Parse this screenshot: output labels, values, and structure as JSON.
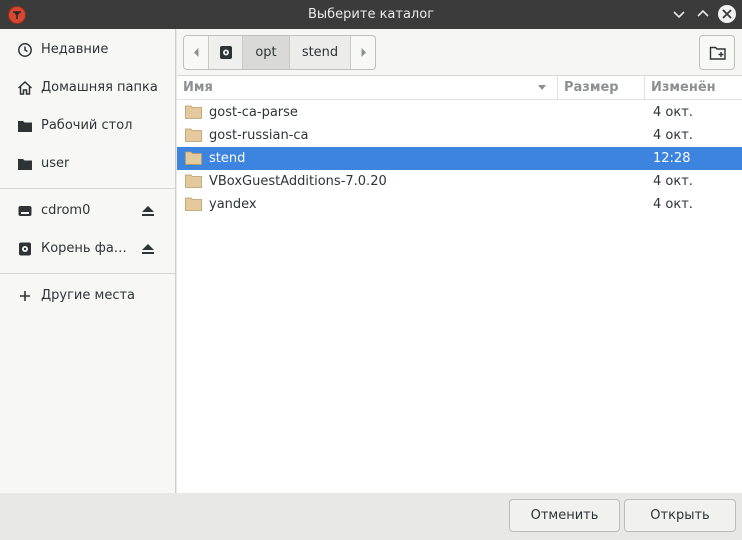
{
  "window": {
    "title": "Выберите каталог"
  },
  "sidebar": {
    "items": [
      {
        "label": "Недавние",
        "icon": "clock-icon"
      },
      {
        "label": "Домашняя папка",
        "icon": "home-icon"
      },
      {
        "label": "Рабочий стол",
        "icon": "folder-icon"
      },
      {
        "label": "user",
        "icon": "folder-icon"
      },
      {
        "label": "cdrom0",
        "icon": "drive-icon",
        "eject": true
      },
      {
        "label": "Корень фа…",
        "icon": "disk-icon",
        "eject": true
      },
      {
        "label": "Другие места",
        "icon": "plus-icon"
      }
    ]
  },
  "pathbar": {
    "crumbs": [
      "opt",
      "stend"
    ]
  },
  "columns": {
    "name": "Имя",
    "size": "Размер",
    "modified": "Изменён"
  },
  "files": [
    {
      "name": "gost-ca-parse",
      "size": "",
      "modified": "4 окт.",
      "selected": false
    },
    {
      "name": "gost-russian-ca",
      "size": "",
      "modified": "4 окт.",
      "selected": false
    },
    {
      "name": "stend",
      "size": "",
      "modified": "12:28",
      "selected": true
    },
    {
      "name": "VBoxGuestAdditions-7.0.20",
      "size": "",
      "modified": "4 окт.",
      "selected": false
    },
    {
      "name": "yandex",
      "size": "",
      "modified": "4 окт.",
      "selected": false
    }
  ],
  "buttons": {
    "cancel": "Отменить",
    "open": "Открыть"
  },
  "colors": {
    "selection": "#3c84e0",
    "titlebar": "#3b3b3b",
    "folder": "#d9b98a"
  }
}
